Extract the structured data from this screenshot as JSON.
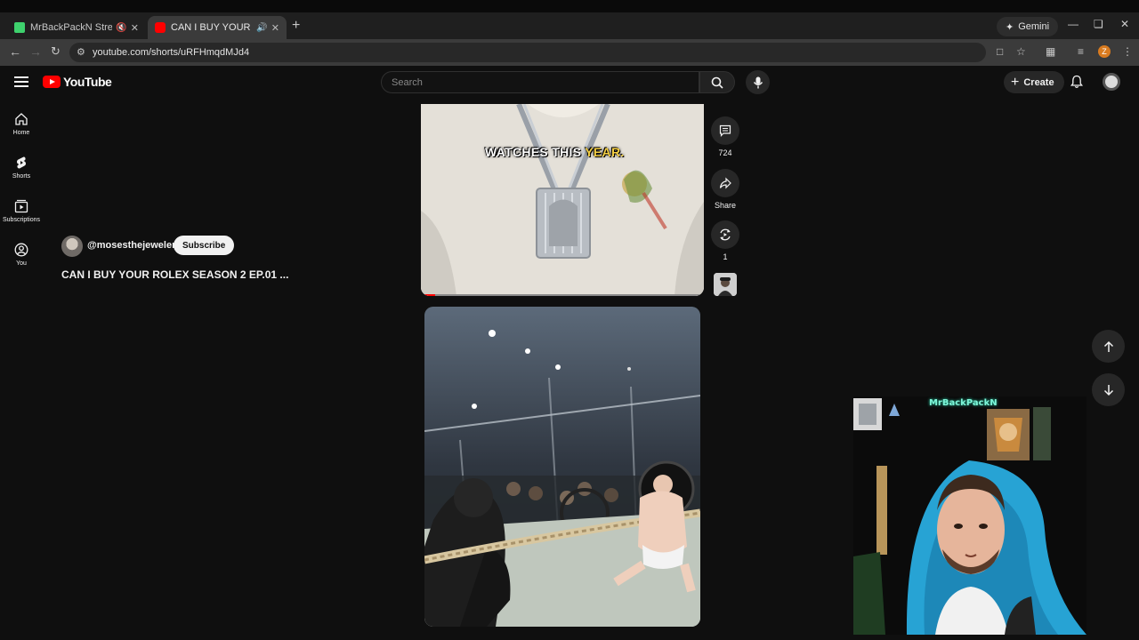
{
  "browser": {
    "tabs": [
      {
        "title": "MrBackPackN Stream - Wa",
        "favicon_color": "#3ed16d",
        "active": false
      },
      {
        "title": "CAN I BUY YOUR ROLEX SE",
        "favicon_color": "#ff0000",
        "active": true
      }
    ],
    "gemini_label": "Gemini",
    "url": "youtube.com/shorts/uRFHmqdMJd4",
    "profile_initial": "Z"
  },
  "yt": {
    "logo_text": "YouTube",
    "search_placeholder": "Search",
    "create_label": "Create",
    "sidebar": [
      {
        "label": "Home",
        "icon": "home-icon"
      },
      {
        "label": "Shorts",
        "icon": "shorts-icon"
      },
      {
        "label": "Subscriptions",
        "icon": "subscriptions-icon"
      },
      {
        "label": "You",
        "icon": "you-icon"
      }
    ]
  },
  "short": {
    "channel": "@mosesthejeweler",
    "subscribe_label": "Subscribe",
    "title": "CAN I BUY YOUR ROLEX SEASON 2 EP.01 ...",
    "caption_white": "WATCHES THIS",
    "caption_yellow": "YEAR.",
    "progress": 0.05,
    "comments_count": "724",
    "share_label": "Share",
    "remix_count": "1"
  },
  "overlay": {
    "stream_logo": "MrBackPackN"
  },
  "colors": {
    "accent": "#ff0000",
    "background": "#0f0f0f"
  }
}
